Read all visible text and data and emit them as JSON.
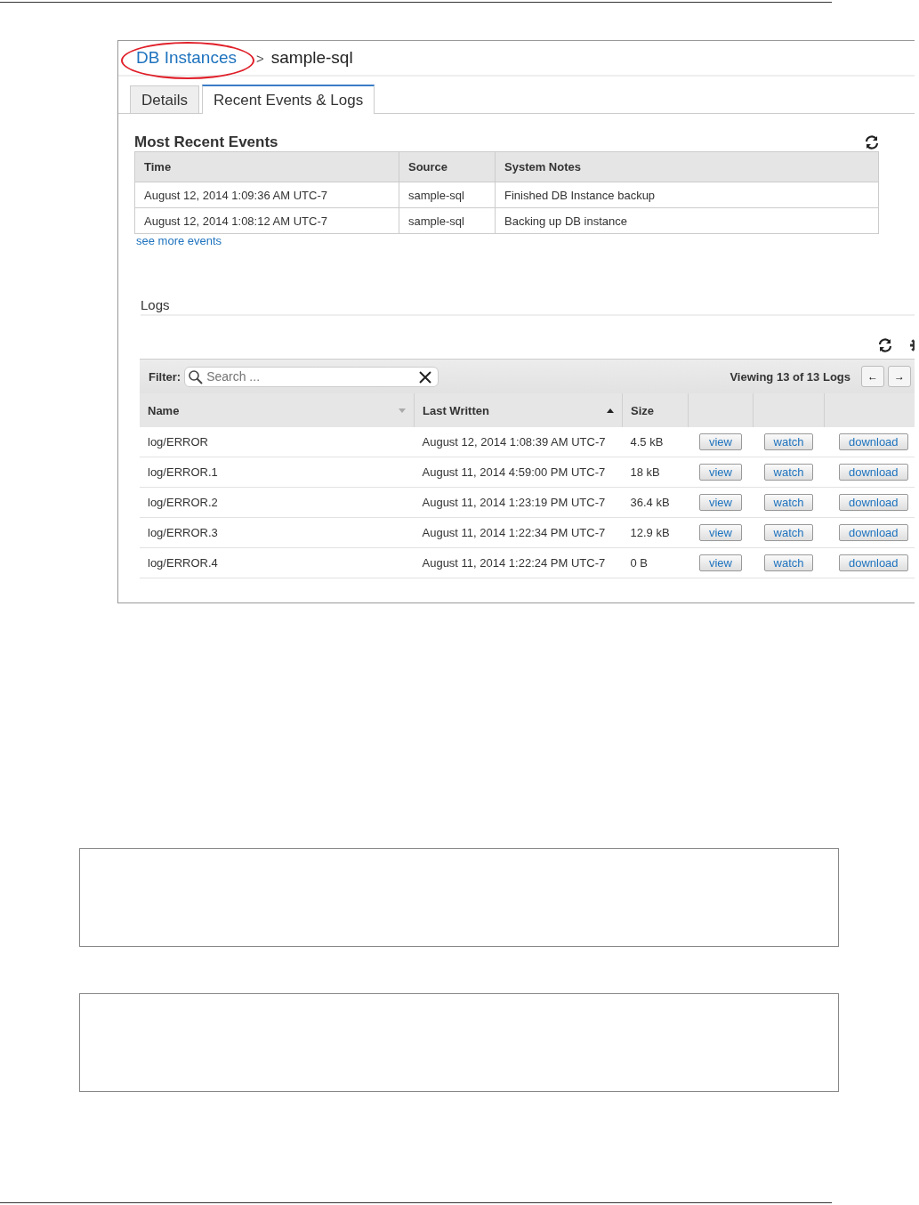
{
  "breadcrumb": {
    "link": "DB Instances",
    "separator": ">",
    "current": "sample-sql"
  },
  "tabs": [
    {
      "label": "Details",
      "selected": false
    },
    {
      "label": "Recent Events & Logs",
      "selected": true
    }
  ],
  "events": {
    "title": "Most Recent Events",
    "columns": [
      "Time",
      "Source",
      "System Notes"
    ],
    "rows": [
      [
        "August 12, 2014 1:09:36 AM UTC-7",
        "sample-sql",
        "Finished DB Instance backup"
      ],
      [
        "August 12, 2014 1:08:12 AM UTC-7",
        "sample-sql",
        "Backing up DB instance"
      ]
    ],
    "more_link": "see more events"
  },
  "logs": {
    "title": "Logs",
    "filter_label": "Filter:",
    "search": {
      "placeholder": "Search ..."
    },
    "viewing": "Viewing 13 of 13 Logs",
    "prev": "←",
    "next": "→",
    "columns": [
      {
        "label": "Name",
        "sorted": false
      },
      {
        "label": "Last Written",
        "sorted": true
      },
      {
        "label": "Size"
      }
    ],
    "rows": [
      {
        "cells": [
          "log/ERROR",
          "August 12, 2014 1:08:39 AM UTC-7",
          "4.5 kB"
        ],
        "actions": [
          "view",
          "watch",
          "download"
        ]
      },
      {
        "cells": [
          "log/ERROR.1",
          "August 11, 2014 4:59:00 PM UTC-7",
          "18 kB"
        ],
        "actions": [
          "view",
          "watch",
          "download"
        ]
      },
      {
        "cells": [
          "log/ERROR.2",
          "August 11, 2014 1:23:19 PM UTC-7",
          "36.4 kB"
        ],
        "actions": [
          "view",
          "watch",
          "download"
        ]
      },
      {
        "cells": [
          "log/ERROR.3",
          "August 11, 2014 1:22:34 PM UTC-7",
          "12.9 kB"
        ],
        "actions": [
          "view",
          "watch",
          "download"
        ]
      },
      {
        "cells": [
          "log/ERROR.4",
          "August 11, 2014 1:22:24 PM UTC-7",
          "0 B"
        ],
        "actions": [
          "view",
          "watch",
          "download"
        ]
      }
    ]
  },
  "boxes": [
    {
      "kind": "empty"
    },
    {
      "kind": "empty"
    }
  ]
}
